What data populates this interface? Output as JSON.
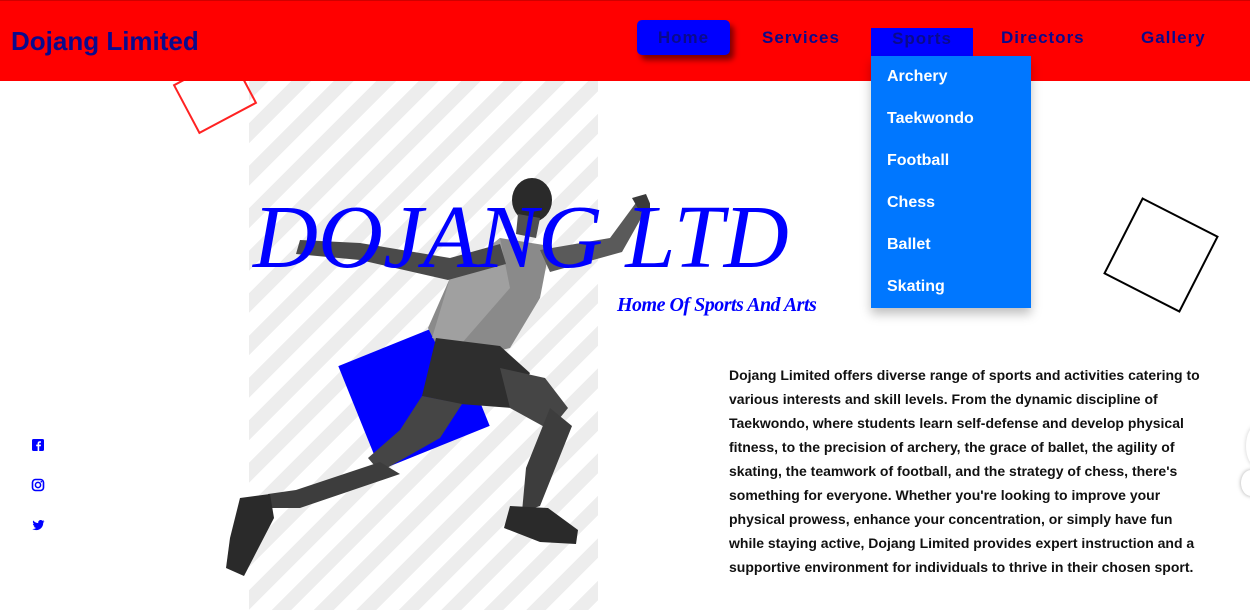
{
  "navbar": {
    "brand": "Dojang Limited",
    "links": {
      "home": "Home",
      "services": "Services",
      "sports": "Sports",
      "directors": "Directors",
      "gallery": "Gallery"
    },
    "sports_menu": [
      "Archery",
      "Taekwondo",
      "Football",
      "Chess",
      "Ballet",
      "Skating"
    ]
  },
  "hero": {
    "title": "DOJANG LTD",
    "subtitle": "Home Of Sports And Arts"
  },
  "about": {
    "text": "Dojang Limited offers diverse range of sports and activities catering to various interests and skill levels. From the dynamic discipline of Taekwondo, where students learn self-defense and develop physical fitness, to the precision of archery, the grace of ballet, the agility of skating, the teamwork of football, and the strategy of chess, there's something for everyone. Whether you're looking to improve your physical prowess, enhance your concentration, or simply have fun while staying active, Dojang Limited provides expert instruction and a supportive environment for individuals to thrive in their chosen sport."
  },
  "social": [
    "facebook-icon",
    "instagram-icon",
    "twitter-icon"
  ],
  "colors": {
    "navbar_bg": "#ff0000",
    "brand_text": "#0a0a8c",
    "accent_blue": "#0000ff",
    "dropdown_bg": "#0077ff"
  }
}
